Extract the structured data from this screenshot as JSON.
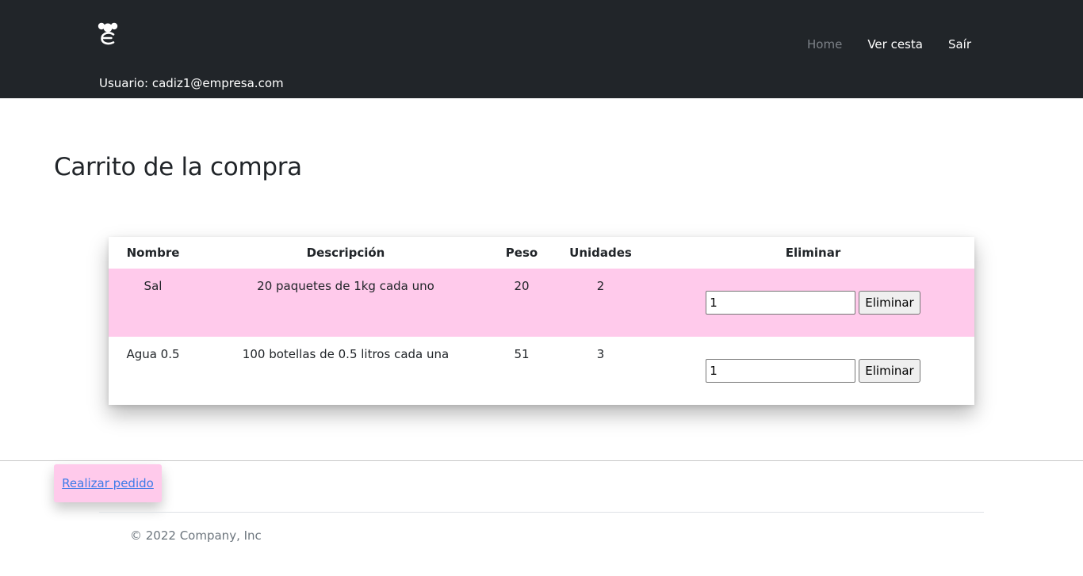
{
  "header": {
    "logo_icon": "mouse-logo-icon",
    "nav": {
      "home": "Home",
      "view_basket": "Ver cesta",
      "logout": "Saír"
    },
    "user_label": "Usuario: cadiz1@empresa.com"
  },
  "main": {
    "title": "Carrito de la compra"
  },
  "cart": {
    "columns": {
      "name": "Nombre",
      "description": "Descripción",
      "weight": "Peso",
      "units": "Unidades",
      "remove": "Eliminar"
    },
    "rows": [
      {
        "name": "Sal",
        "description": "20 paquetes de 1kg cada uno",
        "weight": "20",
        "units": "2",
        "qty_value": "1",
        "remove_label": "Eliminar"
      },
      {
        "name": "Agua 0.5",
        "description": "100 botellas de 0.5 litros cada una",
        "weight": "51",
        "units": "3",
        "qty_value": "1",
        "remove_label": "Eliminar"
      }
    ],
    "highlight_color": "#ffcaeb"
  },
  "actions": {
    "place_order": "Realizar pedido"
  },
  "footer": {
    "copyright": "© 2022 Company, Inc"
  },
  "colors": {
    "header_bg": "#212529",
    "accent_pink": "#ffcaeb",
    "link_blue": "#3d7be8"
  }
}
